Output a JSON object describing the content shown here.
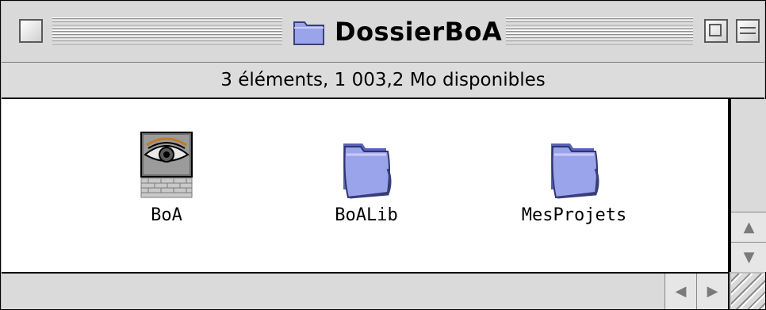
{
  "window": {
    "title": "DossierBoA",
    "title_icon": "folder-icon"
  },
  "info": {
    "status": "3 éléments, 1 003,2  Mo disponibles"
  },
  "items": [
    {
      "label": "BoA",
      "icon": "boa-app-icon"
    },
    {
      "label": "BoALib",
      "icon": "folder-icon"
    },
    {
      "label": "MesProjets",
      "icon": "folder-icon"
    }
  ],
  "colors": {
    "folder": "#9aa4ea",
    "folder_dark": "#5a63b8",
    "chrome": "#d9d9d9"
  }
}
